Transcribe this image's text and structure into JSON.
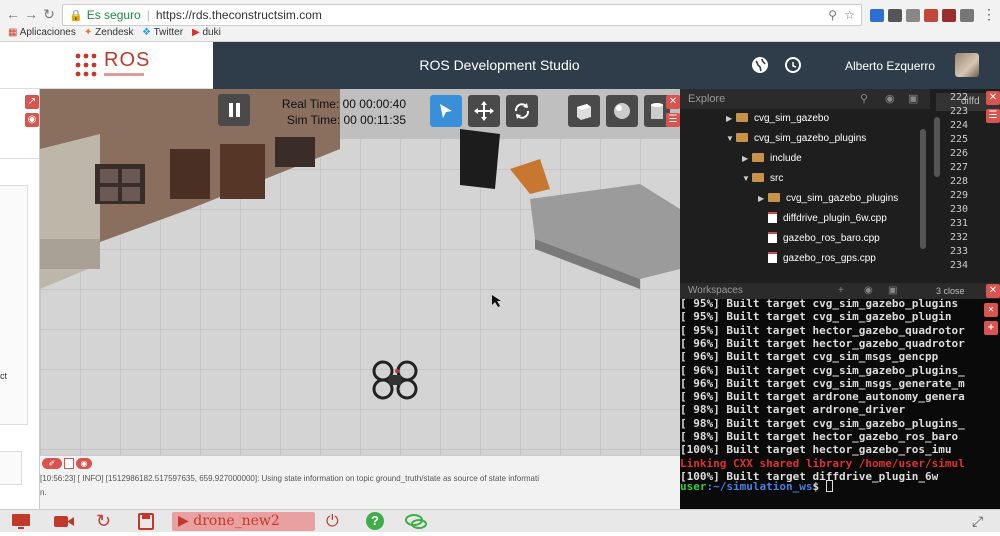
{
  "browser": {
    "secure_label": "Es seguro",
    "url": "https://rds.theconstructsim.com",
    "bookmarks": [
      "Aplicaciones",
      "Zendesk",
      "Twitter",
      "duki"
    ]
  },
  "app": {
    "logo_text": "ROS",
    "title": "ROS Development Studio",
    "user_name": "Alberto Ezquerro"
  },
  "gazebo": {
    "real_time": "Real Time: 00 00:00:40",
    "sim_time": "Sim Time: 00 00:11:35"
  },
  "log": {
    "line": "[10:56:23] [ INFO] [1512986182.517597635, 659.927000000]: Using state information on topic ground_truth/state as source of state informati",
    "line2": "n."
  },
  "explorer": {
    "title": "Explore",
    "items": [
      {
        "label": "cvg_sim_gazebo",
        "type": "folder",
        "indent": 1,
        "expanded": false
      },
      {
        "label": "cvg_sim_gazebo_plugins",
        "type": "folder",
        "indent": 1,
        "expanded": true
      },
      {
        "label": "include",
        "type": "folder",
        "indent": 2,
        "expanded": false
      },
      {
        "label": "src",
        "type": "folder",
        "indent": 2,
        "expanded": true
      },
      {
        "label": "cvg_sim_gazebo_plugins",
        "type": "folder",
        "indent": 3,
        "expanded": false
      },
      {
        "label": "diffdrive_plugin_6w.cpp",
        "type": "file",
        "indent": 3
      },
      {
        "label": "gazebo_ros_baro.cpp",
        "type": "file",
        "indent": 3
      },
      {
        "label": "gazebo_ros_gps.cpp",
        "type": "file",
        "indent": 3
      }
    ]
  },
  "editor": {
    "tab_label": "diffd",
    "line_numbers": [
      "222",
      "223",
      "224",
      "225",
      "226",
      "227",
      "228",
      "229",
      "230",
      "231",
      "232",
      "233",
      "234"
    ]
  },
  "workspaces": {
    "title": "Workspaces",
    "tab_close": "3 close"
  },
  "terminal": {
    "lines": [
      {
        "text": "[ 95%] Built target cvg_sim_gazebo_plugins",
        "color": "#dddddd"
      },
      {
        "text": "[ 95%] Built target cvg_sim_gazebo_plugin",
        "color": "#dddddd"
      },
      {
        "text": "[ 95%] Built target hector_gazebo_quadrotor",
        "color": "#dddddd"
      },
      {
        "text": "[ 96%] Built target hector_gazebo_quadrotor",
        "color": "#dddddd"
      },
      {
        "text": "[ 96%] Built target cvg_sim_msgs_gencpp",
        "color": "#dddddd"
      },
      {
        "text": "[ 96%] Built target cvg_sim_gazebo_plugins_",
        "color": "#dddddd"
      },
      {
        "text": "[ 96%] Built target cvg_sim_msgs_generate_m",
        "color": "#dddddd"
      },
      {
        "text": "[ 96%] Built target ardrone_autonomy_genera",
        "color": "#dddddd"
      },
      {
        "text": "[ 98%] Built target ardrone_driver",
        "color": "#dddddd"
      },
      {
        "text": "[ 98%] Built target cvg_sim_gazebo_plugins_",
        "color": "#dddddd"
      },
      {
        "text": "[ 98%] Built target hector_gazebo_ros_baro",
        "color": "#dddddd"
      },
      {
        "text": "[100%] Built target hector_gazebo_ros_imu",
        "color": "#dddddd"
      },
      {
        "text": "Linking CXX shared library /home/user/simul",
        "color": "#e03030"
      },
      {
        "text": "[100%] Built target diffdrive_plugin_6w",
        "color": "#dddddd"
      }
    ],
    "prompt_user": "user",
    "prompt_path": ":~/simulation_ws",
    "prompt_symbol": "$"
  },
  "toolbar": {
    "project_name": "drone_new2"
  },
  "left_panel": {
    "fragment": "ct"
  }
}
